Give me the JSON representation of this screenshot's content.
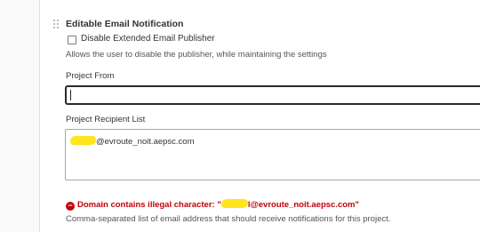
{
  "section": {
    "title": "Editable Email Notification",
    "disable_label": "Disable Extended Email Publisher",
    "disable_checked": false,
    "disable_help": "Allows the user to disable the publisher, while maintaining the settings"
  },
  "project_from": {
    "label": "Project From",
    "value": ""
  },
  "recipient_list": {
    "label": "Project Recipient List",
    "value_suffix": "@evroute_noit.aepsc.com",
    "error_prefix": "Domain contains illegal character: \"",
    "error_value_suffix": "l@evroute_noit.aepsc.com\"",
    "helper": "Comma-separated list of email address that should receive notifications for this project."
  },
  "colors": {
    "error": "#c4000a",
    "highlight": "#ffe51a",
    "focus_border": "#2b2b2b"
  },
  "icons": {
    "drag_handle": "drag-handle-icon",
    "error": "error-icon"
  }
}
